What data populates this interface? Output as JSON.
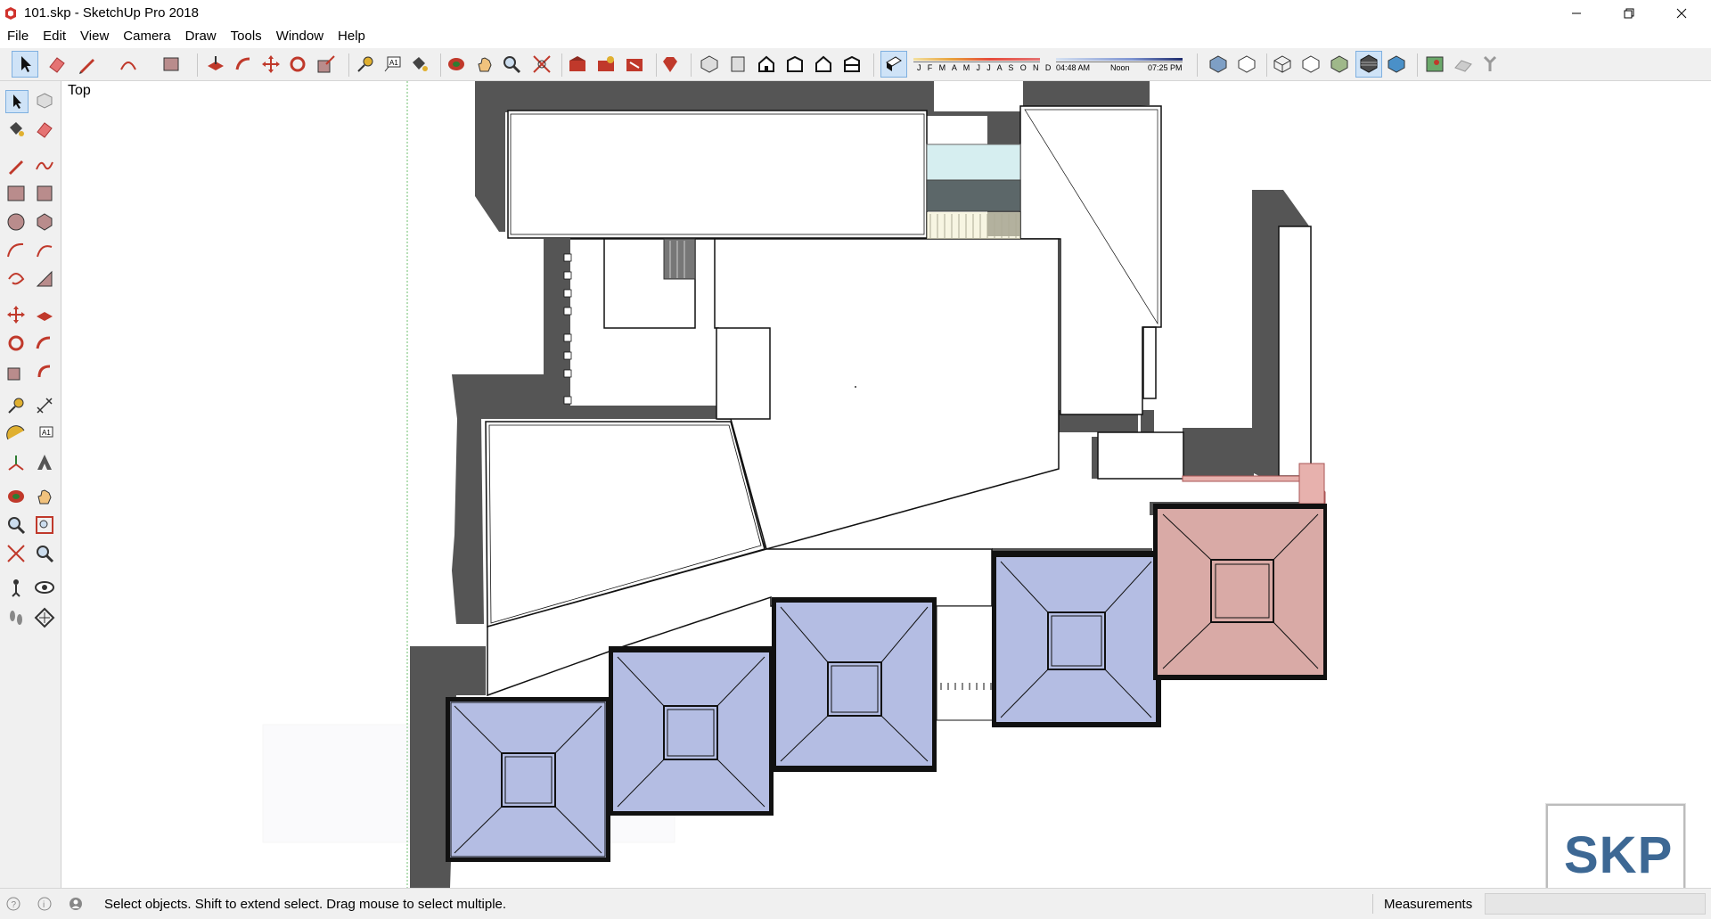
{
  "window": {
    "title": "101.skp - SketchUp Pro 2018",
    "minimize_glyph": "—",
    "restore_glyph": "❐",
    "close_glyph": "✕"
  },
  "menu": [
    "File",
    "Edit",
    "View",
    "Camera",
    "Draw",
    "Tools",
    "Window",
    "Help"
  ],
  "toolbar": {
    "shadow_months": "J F M A M J J A S O N D",
    "time_start": "04:48 AM",
    "time_noon": "Noon",
    "time_end": "07:25 PM"
  },
  "canvas": {
    "view_label": "Top"
  },
  "statusbar": {
    "hint": "Select objects. Shift to extend select. Drag mouse to select multiple.",
    "measurements_label": "Measurements",
    "measurements_value": ""
  },
  "badge": {
    "text": "SKP"
  },
  "colors": {
    "shadow": "#555555",
    "skylight_blue": "#b4bde3",
    "skylight_pink": "#d9aaa6",
    "accent_red": "#c0392b"
  }
}
